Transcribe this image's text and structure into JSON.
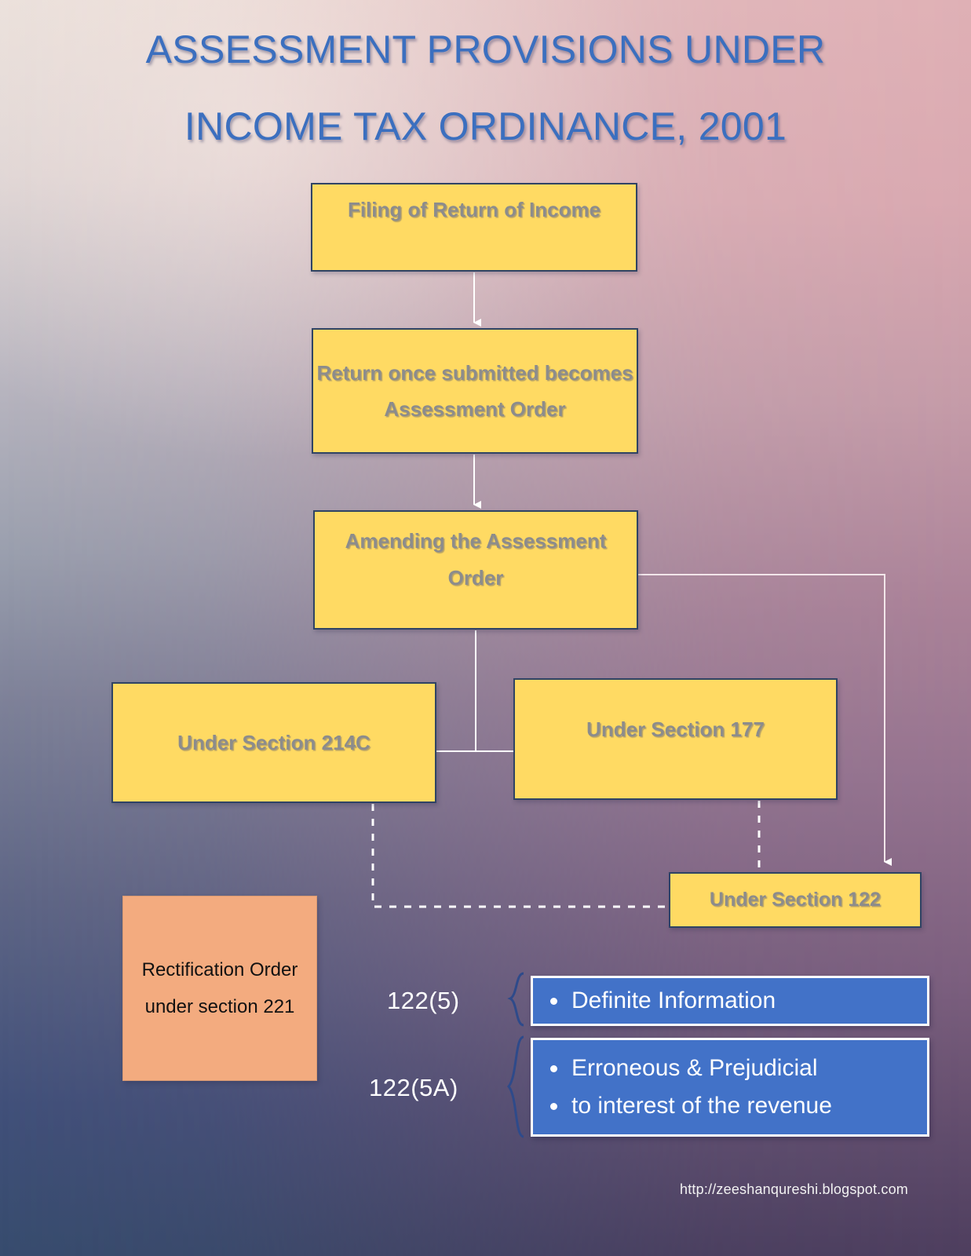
{
  "title": {
    "line1": "ASSESSMENT PROVISIONS UNDER",
    "line2": "INCOME TAX ORDINANCE, 2001",
    "color": "#3b6fbf"
  },
  "flow": {
    "boxes": [
      {
        "id": "filing",
        "label": "Filing of Return of Income"
      },
      {
        "id": "return",
        "label": "Return once submitted becomes Assessment Order"
      },
      {
        "id": "amending",
        "label": "Amending the Assessment Order"
      },
      {
        "id": "s214c",
        "label": "Under Section 214C"
      },
      {
        "id": "s177",
        "label": "Under Section 177"
      },
      {
        "id": "s122",
        "label": "Under Section 122"
      }
    ],
    "box_fill": "#ffda63",
    "box_border": "#2f4364",
    "box_text_color": "#8c8c8c"
  },
  "rectification": {
    "label": "Rectification Order under section 221",
    "fill": "#f3ab7f",
    "text_color": "#111111"
  },
  "subsections": [
    {
      "code": "122(5)",
      "fill": "#4272c8",
      "items": [
        "Definite Information"
      ]
    },
    {
      "code": "122(5A)",
      "fill": "#4272c8",
      "items": [
        "Erroneous & Prejudicial",
        "to interest of the revenue"
      ]
    }
  ],
  "footer": {
    "url": "http://zeeshanqureshi.blogspot.com"
  },
  "background": {
    "top_left": "#e9dfda",
    "top_right": "#dfb0b5",
    "bottom_left": "#374c6e",
    "bottom_right": "#4e3e5e"
  },
  "chart_data": {
    "type": "diagram",
    "title": "ASSESSMENT PROVISIONS UNDER INCOME TAX ORDINANCE, 2001",
    "nodes": [
      {
        "id": "filing",
        "label": "Filing of Return of Income",
        "style": "yellow"
      },
      {
        "id": "return",
        "label": "Return once submitted becomes Assessment Order",
        "style": "yellow"
      },
      {
        "id": "amending",
        "label": "Amending the Assessment Order",
        "style": "yellow"
      },
      {
        "id": "s214c",
        "label": "Under Section 214C",
        "style": "yellow"
      },
      {
        "id": "s177",
        "label": "Under Section 177",
        "style": "yellow"
      },
      {
        "id": "s122",
        "label": "Under Section 122",
        "style": "yellow"
      },
      {
        "id": "rect",
        "label": "Rectification Order under section 221",
        "style": "peach"
      },
      {
        "id": "b1",
        "label": "Definite Information",
        "style": "blue"
      },
      {
        "id": "b2",
        "label": "Erroneous & Prejudicial / to interest of the revenue",
        "style": "blue"
      }
    ],
    "edges": [
      {
        "from": "filing",
        "to": "return",
        "style": "solid-arrow"
      },
      {
        "from": "return",
        "to": "amending",
        "style": "solid-arrow"
      },
      {
        "from": "amending",
        "to": "s214c",
        "style": "solid"
      },
      {
        "from": "amending",
        "to": "s177",
        "style": "solid"
      },
      {
        "from": "amending",
        "to": "s122",
        "style": "solid-arrow"
      },
      {
        "from": "s214c",
        "to": "s122",
        "style": "dashed"
      },
      {
        "from": "s177",
        "to": "s122",
        "style": "dashed"
      },
      {
        "from": "s122",
        "to": "b1",
        "style": "brace",
        "label": "122(5)"
      },
      {
        "from": "s122",
        "to": "b2",
        "style": "brace",
        "label": "122(5A)"
      }
    ]
  }
}
